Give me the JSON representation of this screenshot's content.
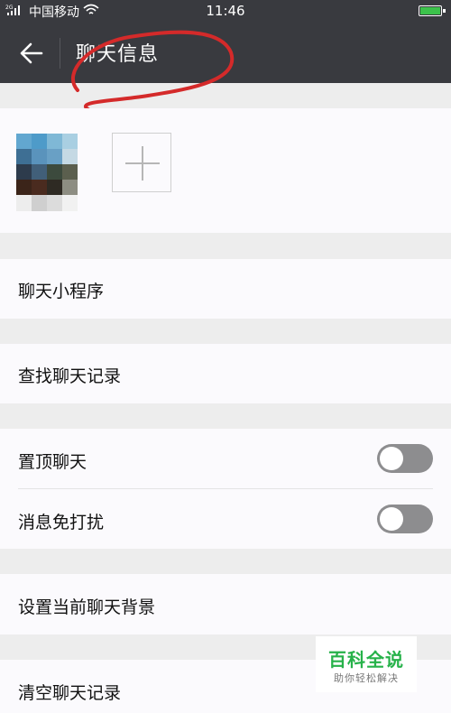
{
  "status_bar": {
    "signal": "2G",
    "carrier": "中国移动",
    "time": "11:46"
  },
  "header": {
    "title": "聊天信息"
  },
  "rows": {
    "mini_programs": "聊天小程序",
    "search_history": "查找聊天记录",
    "sticky_on_top": "置顶聊天",
    "mute_notifications": "消息免打扰",
    "set_background": "设置当前聊天背景",
    "clear_history": "清空聊天记录"
  },
  "toggles": {
    "sticky_on_top": false,
    "mute_notifications": false
  },
  "watermark": {
    "title": "百科全说",
    "subtitle": "助你轻松解决"
  },
  "colors": {
    "header_bg": "#393a3f",
    "page_bg": "#ededed",
    "row_bg": "#fbfafd",
    "toggle_off": "#8d8d8f",
    "annotation": "#d42a2a",
    "battery": "#3cc24b",
    "watermark_green": "#27b24a"
  }
}
